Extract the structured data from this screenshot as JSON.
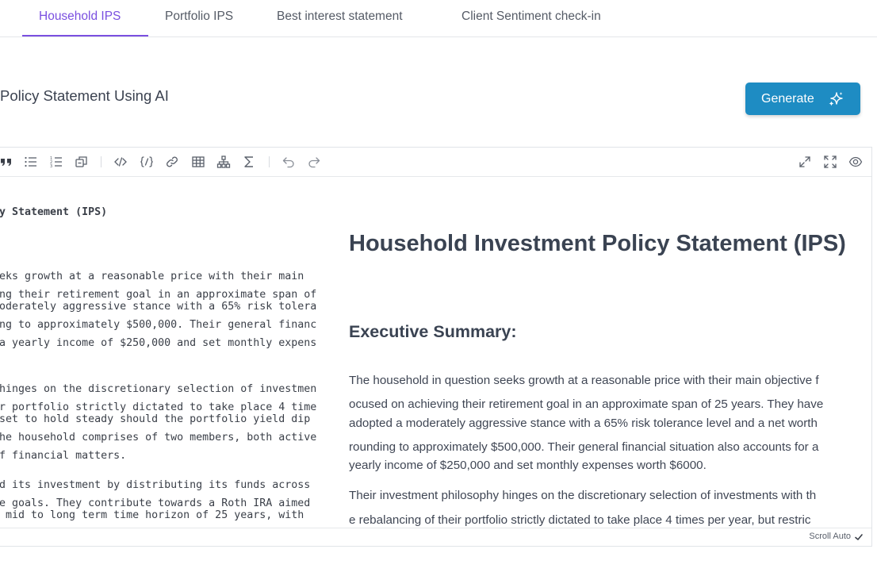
{
  "tabs": [
    {
      "label": "Household IPS",
      "active": true
    },
    {
      "label": "Portfolio IPS"
    },
    {
      "label": "Best interest statement"
    },
    {
      "label": "Client Sentiment check-in"
    }
  ],
  "page_title": "Policy Statement Using AI",
  "generate_button": {
    "label": "Generate",
    "icon": "sparkle-icon"
  },
  "colors": {
    "accent": "#7a4fe0",
    "button": "#1e8cc3"
  },
  "toolbar": {
    "icons": [
      "quote-icon",
      "bullet-list-icon",
      "numbered-list-icon",
      "copy-icon",
      "code-icon",
      "code-block-icon",
      "link-icon",
      "table-icon",
      "diagram-icon",
      "formula-icon",
      "undo-icon",
      "redo-icon",
      "expand-icon",
      "fullscreen-icon",
      "preview-eye-icon"
    ]
  },
  "source_lines": [
    "y Statement (IPS)",
    "eks growth at a reasonable price with their main",
    "ng their retirement goal in an approximate span of",
    "oderately aggressive stance with a 65% risk tolera",
    "ng to approximately $500,000. Their general financ",
    "a yearly income of $250,000 and set monthly expens",
    "hinges on the discretionary selection of investmen",
    "r portfolio strictly dictated to take place 4 time",
    "set to hold steady should the portfolio yield dip",
    "he household comprises of two members, both active",
    "f financial matters.",
    "d its investment by distributing its funds across",
    "e goals. They contribute towards a Roth IRA aimed",
    " mid to long term time horizon of 25 years, with"
  ],
  "preview": {
    "h1": "Household Investment Policy Statement (IPS)",
    "h2": "Executive Summary:",
    "lines": [
      "The household in question seeks growth at a reasonable price with their main objective f",
      "ocused on achieving their retirement goal in an approximate span of 25 years. They have",
      "adopted a moderately aggressive stance with a 65% risk tolerance level and a net worth",
      "rounding to approximately $500,000. Their general financial situation also accounts for a",
      "yearly income of $250,000 and set monthly expenses worth $6000.",
      "Their investment philosophy hinges on the discretionary selection of investments with th",
      "e rebalancing of their portfolio strictly dictated to take place 4 times per year, but restric"
    ]
  },
  "status": {
    "scroll_auto": "Scroll Auto"
  }
}
